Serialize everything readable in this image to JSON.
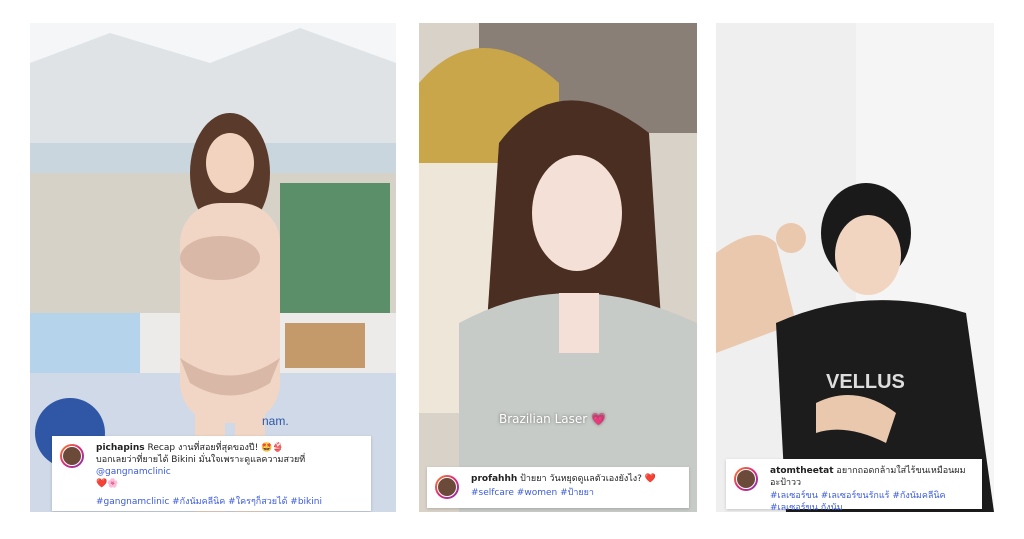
{
  "posts": [
    {
      "username": "pichapins",
      "caption_line1": "Recap งานที่สอยที่สุดของปี! 🤩👙",
      "caption_line2": "บอกเลยว่าที่ยายได้ Bikini มั่นใจเพราะดูแลความสวยที่",
      "mention": "@gangnamclinic",
      "emoji": "❤️🌸",
      "hashtags": "#gangnamclinic #กังนัมคลีนิค #ใครๆก็สวยได้ #bikini",
      "photo_text": "nam."
    },
    {
      "username": "profahhh",
      "caption_line1": "ป้ายยา วันหยุดดูแลตัวเองยังไง?",
      "emoji": "❤️",
      "hashtags": "#selfcare #women #ป้ายยา",
      "overlay": "Brazilian Laser 💗"
    },
    {
      "username": "atomtheetat",
      "caption_line1": "อยากถอดกล้ามใส่ไร้ขนเหมือนผมอะป้าวว",
      "hashtags": "#เลเซอร์ขน #เลเซอร์ขนรักแร้ #กังนัมคลีนิค #เลเซอร์ขน กังนัม",
      "photo_text": "VELLUS"
    }
  ]
}
